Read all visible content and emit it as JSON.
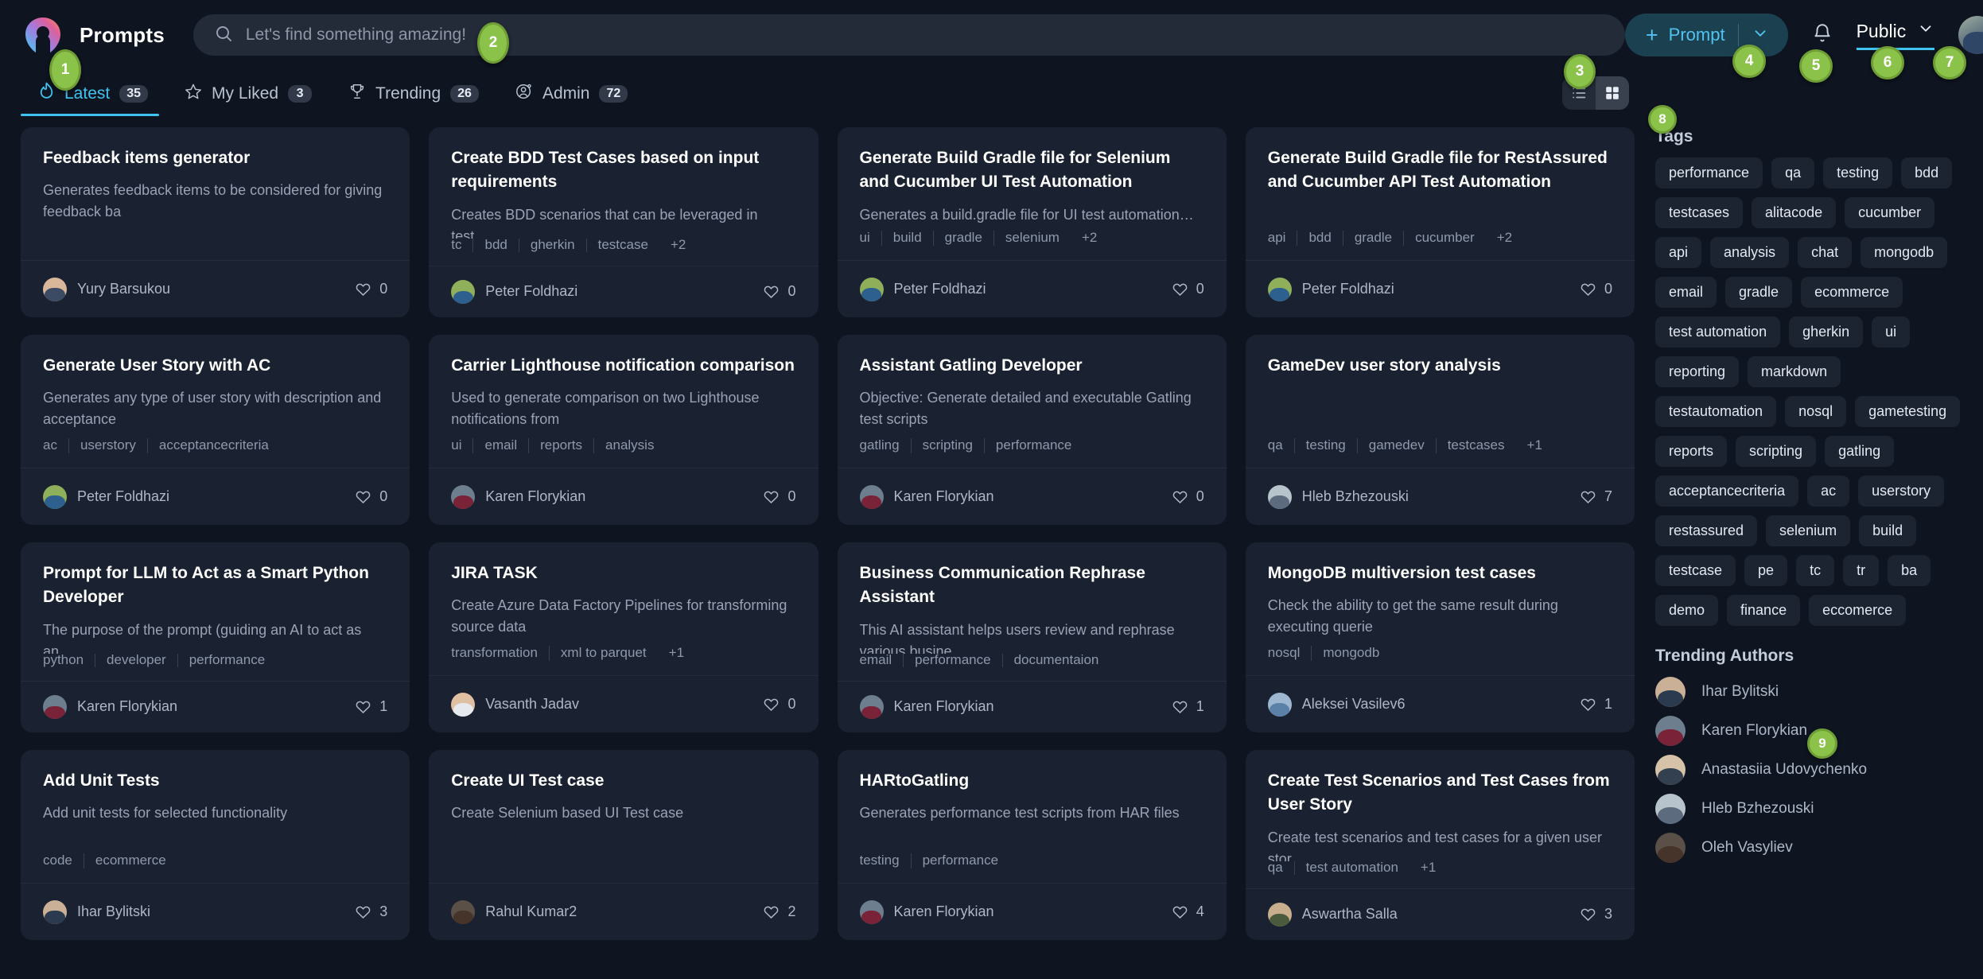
{
  "header": {
    "brand": "Prompts",
    "logo_icon": "prompts-logo-icon",
    "search": {
      "icon": "search-icon",
      "placeholder": "Let's find something amazing!",
      "value": ""
    },
    "prompt_button": {
      "plus_icon": "plus-icon",
      "label": "Prompt",
      "chevron_icon": "chevron-down-icon"
    },
    "bell_icon": "notification-bell-icon",
    "visibility": {
      "label": "Public",
      "chevron_icon": "chevron-down-icon"
    },
    "avatar_icon": "user-avatar"
  },
  "tabs": [
    {
      "label": "Latest",
      "count": "35",
      "icon": "flame-icon",
      "active": true
    },
    {
      "label": "My Liked",
      "count": "3",
      "icon": "star-icon",
      "active": false
    },
    {
      "label": "Trending",
      "count": "26",
      "icon": "trophy-icon",
      "active": false
    },
    {
      "label": "Admin",
      "count": "72",
      "icon": "user-gear-icon",
      "active": false
    }
  ],
  "view_toggle": {
    "list_icon": "list-view-icon",
    "grid_icon": "grid-view-icon",
    "active": "grid"
  },
  "cards": [
    {
      "title": "Feedback items generator",
      "desc": "Generates feedback items to be considered for giving feedback ba",
      "tags": [],
      "more": "",
      "author": "Yury Barsukou",
      "likes": "0",
      "av": "av-a"
    },
    {
      "title": "Create BDD Test Cases based on input requirements",
      "desc": "Creates BDD scenarios that can be leveraged in test…",
      "tags": [
        "tc",
        "bdd",
        "gherkin",
        "testcase"
      ],
      "more": "+2",
      "author": "Peter Foldhazi",
      "likes": "0",
      "av": "av-b"
    },
    {
      "title": "Generate Build Gradle file for Selenium and Cucumber UI Test Automation",
      "desc": "Generates a build.gradle file for UI test automation…",
      "tags": [
        "ui",
        "build",
        "gradle",
        "selenium"
      ],
      "more": "+2",
      "author": "Peter Foldhazi",
      "likes": "0",
      "av": "av-b"
    },
    {
      "title": "Generate Build Gradle file for RestAssured and Cucumber API Test Automation",
      "desc": "",
      "tags": [
        "api",
        "bdd",
        "gradle",
        "cucumber"
      ],
      "more": "+2",
      "author": "Peter Foldhazi",
      "likes": "0",
      "av": "av-b"
    },
    {
      "title": "Generate User Story with AC",
      "desc": "Generates any type of user story with description and acceptance",
      "tags": [
        "ac",
        "userstory",
        "acceptancecriteria"
      ],
      "more": "",
      "author": "Peter Foldhazi",
      "likes": "0",
      "av": "av-b"
    },
    {
      "title": "Carrier Lighthouse notification comparison",
      "desc": "Used to generate comparison on two Lighthouse notifications from",
      "tags": [
        "ui",
        "email",
        "reports",
        "analysis"
      ],
      "more": "",
      "author": "Karen Florykian",
      "likes": "0",
      "av": "av-c"
    },
    {
      "title": "Assistant Gatling Developer",
      "desc": "Objective: Generate detailed and executable Gatling test scripts",
      "tags": [
        "gatling",
        "scripting",
        "performance"
      ],
      "more": "",
      "author": "Karen Florykian",
      "likes": "0",
      "av": "av-c"
    },
    {
      "title": "GameDev user story analysis",
      "desc": "",
      "tags": [
        "qa",
        "testing",
        "gamedev",
        "testcases"
      ],
      "more": "+1",
      "author": "Hleb Bzhezouski",
      "likes": "7",
      "av": "av-d"
    },
    {
      "title": "Prompt for LLM to Act as a Smart Python Developer",
      "desc": "The purpose of the prompt (guiding an AI to act as an…",
      "tags": [
        "python",
        "developer",
        "performance"
      ],
      "more": "",
      "author": "Karen Florykian",
      "likes": "1",
      "av": "av-c"
    },
    {
      "title": "JIRA TASK",
      "desc": "Create Azure Data Factory Pipelines for transforming source data",
      "tags": [
        "transformation",
        "xml to parquet"
      ],
      "more": "+1",
      "author": "Vasanth Jadav",
      "likes": "0",
      "av": "av-e"
    },
    {
      "title": "Business Communication Rephrase Assistant",
      "desc": "This AI assistant helps users review and rephrase various busine",
      "tags": [
        "email",
        "performance",
        "documentaion"
      ],
      "more": "",
      "author": "Karen Florykian",
      "likes": "1",
      "av": "av-c"
    },
    {
      "title": "MongoDB multiversion test cases",
      "desc": "Check the ability to get the same result during executing querie",
      "tags": [
        "nosql",
        "mongodb"
      ],
      "more": "",
      "author": "Aleksei Vasilev6",
      "likes": "1",
      "av": "av-g"
    },
    {
      "title": "Add Unit Tests",
      "desc": "Add unit tests for selected functionality",
      "tags": [
        "code",
        "ecommerce"
      ],
      "more": "",
      "author": "Ihar Bylitski",
      "likes": "3",
      "av": "av-f"
    },
    {
      "title": "Create UI Test case",
      "desc": "Create Selenium based UI Test case",
      "tags": [],
      "more": "",
      "author": "Rahul Kumar2",
      "likes": "2",
      "av": "av-h"
    },
    {
      "title": "HARtoGatling",
      "desc": "Generates performance test scripts from HAR files",
      "tags": [
        "testing",
        "performance"
      ],
      "more": "",
      "author": "Karen Florykian",
      "likes": "4",
      "av": "av-c"
    },
    {
      "title": "Create Test Scenarios and Test Cases from User Story",
      "desc": "Create test scenarios and test cases for a given user stor…",
      "tags": [
        "qa",
        "test automation"
      ],
      "more": "+1",
      "author": "Aswartha Salla",
      "likes": "3",
      "av": "av-i"
    }
  ],
  "sidebar": {
    "tags_heading": "Tags",
    "tags": [
      "performance",
      "qa",
      "testing",
      "bdd",
      "testcases",
      "alitacode",
      "cucumber",
      "api",
      "analysis",
      "chat",
      "mongodb",
      "email",
      "gradle",
      "ecommerce",
      "test automation",
      "gherkin",
      "ui",
      "reporting",
      "markdown",
      "testautomation",
      "nosql",
      "gametesting",
      "reports",
      "scripting",
      "gatling",
      "acceptancecriteria",
      "ac",
      "userstory",
      "restassured",
      "selenium",
      "build",
      "testcase",
      "pe",
      "tc",
      "tr",
      "ba",
      "demo",
      "finance",
      "eccomerce"
    ],
    "authors_heading": "Trending Authors",
    "authors": [
      {
        "name": "Ihar Bylitski",
        "av": "av-f"
      },
      {
        "name": "Karen Florykian",
        "av": "av-c"
      },
      {
        "name": "Anastasiia Udovychenko",
        "av": "av-j"
      },
      {
        "name": "Hleb Bzhezouski",
        "av": "av-d"
      },
      {
        "name": "Oleh Vasyliev",
        "av": "av-h"
      }
    ]
  },
  "callouts": [
    {
      "n": "1"
    },
    {
      "n": "2"
    },
    {
      "n": "3"
    },
    {
      "n": "4"
    },
    {
      "n": "5"
    },
    {
      "n": "6"
    },
    {
      "n": "7"
    },
    {
      "n": "8"
    },
    {
      "n": "9"
    }
  ],
  "colors": {
    "page_bg": "#0e1420",
    "card_bg": "#1a2130",
    "accent": "#3fc4f0",
    "callout": "#8bc34a",
    "tag_pill_bg": "#1c2331"
  }
}
